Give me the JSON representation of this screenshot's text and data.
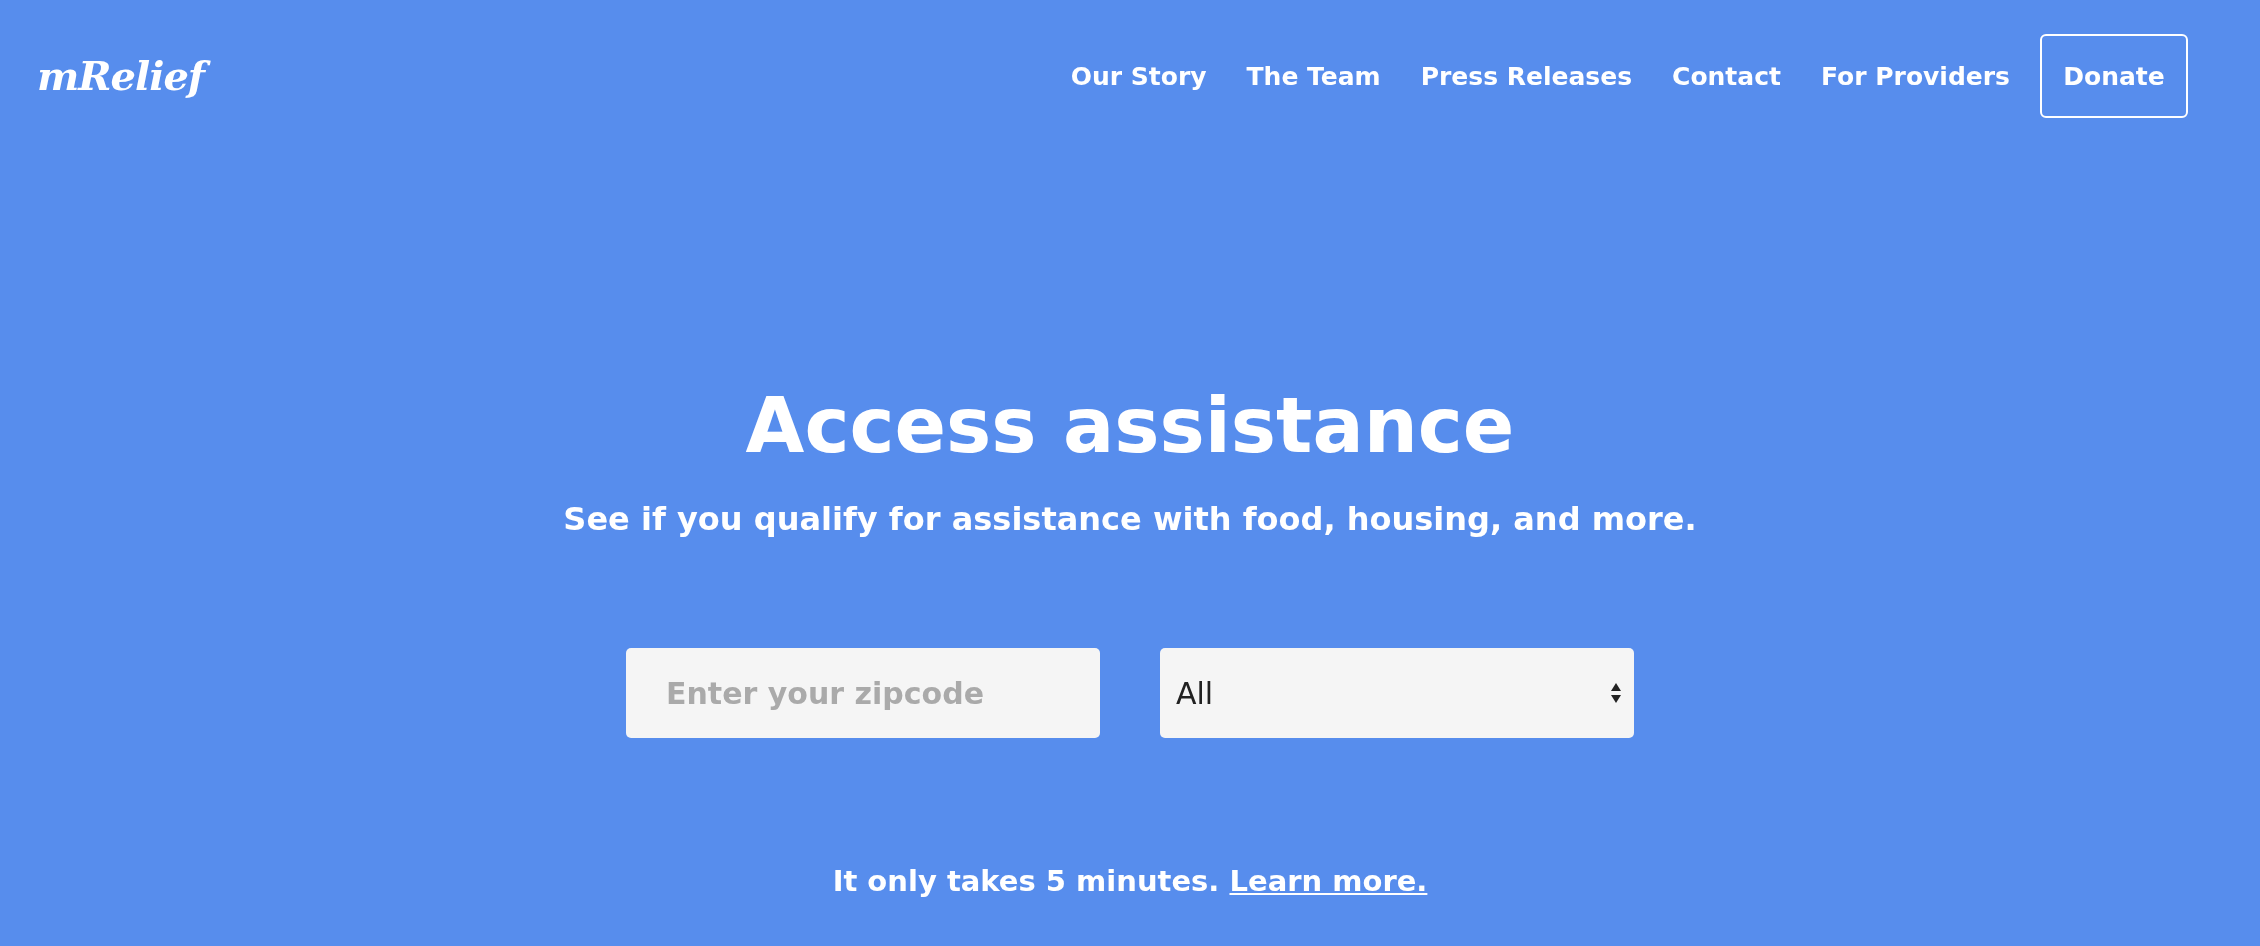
{
  "header": {
    "logo": "mRelief",
    "nav": [
      {
        "label": "Our Story"
      },
      {
        "label": "The Team"
      },
      {
        "label": "Press Releases"
      },
      {
        "label": "Contact"
      },
      {
        "label": "For Providers"
      }
    ],
    "donate_button": "Donate"
  },
  "hero": {
    "title": "Access assistance",
    "subtitle": "See if you qualify for assistance with food, housing, and more.",
    "zipcode_field": {
      "placeholder": "Enter your zipcode"
    },
    "category_select": {
      "value": "All"
    },
    "note": "It only takes 5 minutes.",
    "note_link": "Learn more."
  }
}
